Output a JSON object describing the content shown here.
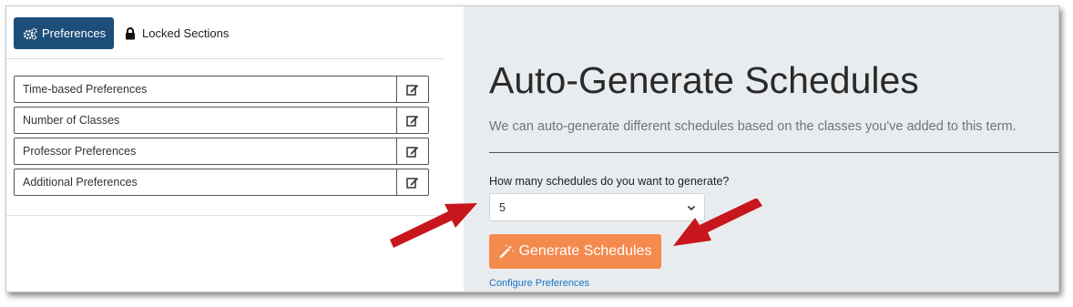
{
  "tabs": {
    "preferences": "Preferences",
    "locked": "Locked Sections"
  },
  "preferences": {
    "items": [
      {
        "label": "Time-based Preferences"
      },
      {
        "label": "Number of Classes"
      },
      {
        "label": "Professor Preferences"
      },
      {
        "label": "Additional Preferences"
      }
    ]
  },
  "main": {
    "title": "Auto-Generate Schedules",
    "subtitle": "We can auto-generate different schedules based on the classes you've added to this term.",
    "question": "How many schedules do you want to generate?",
    "schedule_count": "5",
    "generate_label": "Generate Schedules",
    "configure_link": "Configure Preferences"
  },
  "colors": {
    "active_tab": "#1d4e7a",
    "generate_button": "#f58a4e",
    "panel_background": "#e9ecef",
    "annotation_arrow": "#c8161d",
    "link": "#1a73c8"
  },
  "icons": [
    "cogs-icon",
    "lock-icon",
    "edit-icon",
    "chevron-down-icon",
    "magic-wand-icon",
    "annotation-arrow"
  ]
}
